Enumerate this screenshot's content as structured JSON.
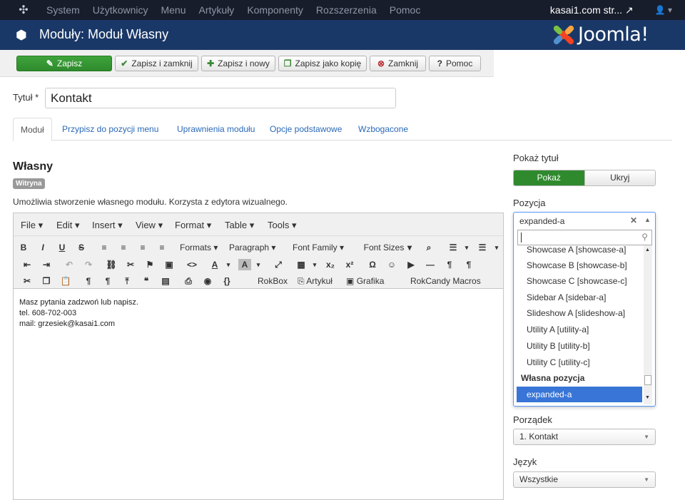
{
  "topnav": {
    "menu": [
      "System",
      "Użytkownicy",
      "Menu",
      "Artykuły",
      "Komponenty",
      "Rozszerzenia",
      "Pomoc"
    ],
    "site_link": "kasai1.com str... ↗",
    "user_icon": "user-icon"
  },
  "header": {
    "title": "Moduły: Moduł Własny",
    "brand": "Joomla!"
  },
  "toolbar": {
    "save": "Zapisz",
    "save_close": "Zapisz i zamknij",
    "save_new": "Zapisz i nowy",
    "save_copy": "Zapisz jako kopię",
    "close": "Zamknij",
    "help": "Pomoc"
  },
  "form": {
    "title_label": "Tytuł *",
    "title_value": "Kontakt"
  },
  "tabs": [
    "Moduł",
    "Przypisz do pozycji menu",
    "Uprawnienia modułu",
    "Opcje podstawowe",
    "Wzbogacone"
  ],
  "module": {
    "name": "Własny",
    "badge": "Witryna",
    "description": "Umożliwia stworzenie własnego modułu. Korzysta z edytora wizualnego."
  },
  "editor": {
    "menus": [
      "File",
      "Edit",
      "Insert",
      "View",
      "Format",
      "Table",
      "Tools"
    ],
    "formats": "Formats",
    "paragraph": "Paragraph",
    "font_family": "Font Family",
    "font_sizes": "Font Sizes",
    "rokbox": "RokBox",
    "artykul": "Artykuł",
    "grafika": "Grafika",
    "rokcandy": "RokCandy Macros",
    "content": [
      "Masz pytania zadzwoń lub napisz.",
      "tel. 608-702-003",
      "mail: grzesiek@kasai1.com"
    ]
  },
  "right": {
    "show_title_label": "Pokaż tytuł",
    "show": "Pokaż",
    "hide": "Ukryj",
    "position_label": "Pozycja",
    "position_value": "expanded-a",
    "position_options": [
      "Showcase A [showcase-a]",
      "Showcase B [showcase-b]",
      "Showcase C [showcase-c]",
      "Sidebar A [sidebar-a]",
      "Slideshow A [slideshow-a]",
      "Utility A [utility-a]",
      "Utility B [utility-b]",
      "Utility C [utility-c]"
    ],
    "custom_group": "Własna pozycja",
    "custom_option": "expanded-a",
    "order_label": "Porządek",
    "order_value": "1. Kontakt",
    "language_label": "Język",
    "language_value": "Wszystkie"
  },
  "colors": {
    "topnav": "#171d2b",
    "header": "#1a3867",
    "save_green": "#2f8a2d",
    "link_blue": "#2a69b8",
    "highlight": "#3875d7"
  }
}
